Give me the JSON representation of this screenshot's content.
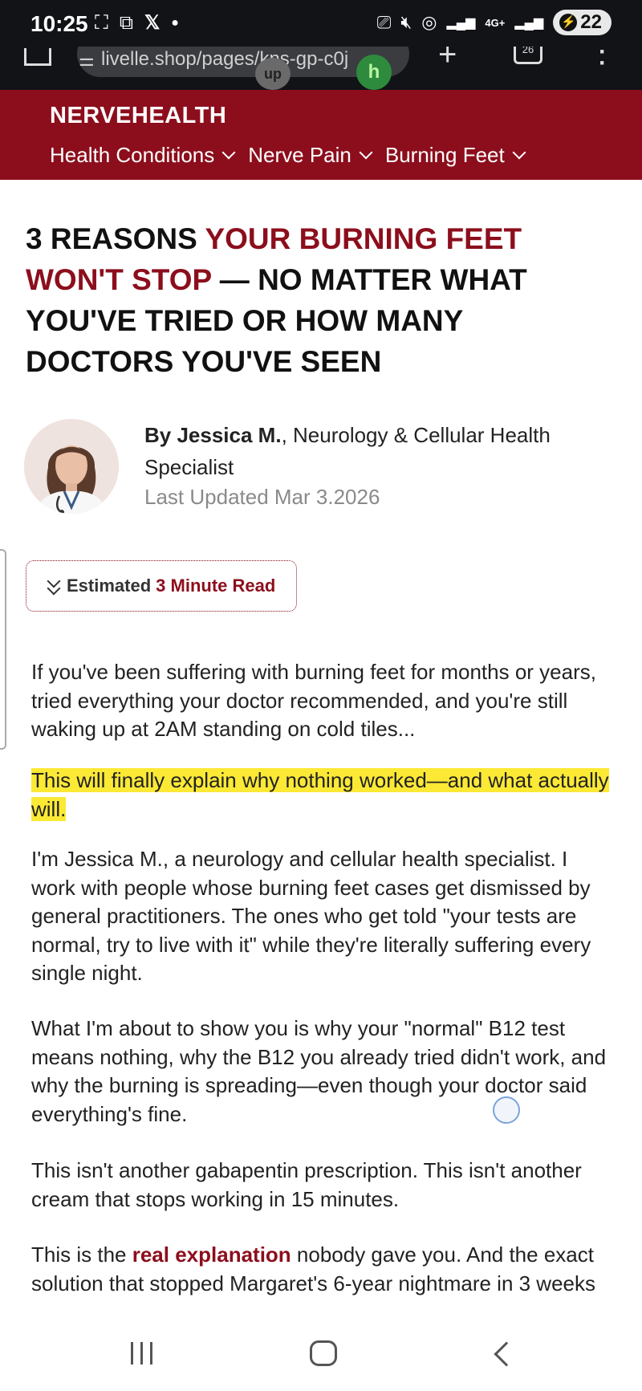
{
  "status_bar": {
    "time": "10:25",
    "left_icons": [
      "screenshot-icon",
      "screen-record-icon",
      "x-app-icon",
      "dot-icon"
    ],
    "network": "4G+",
    "battery": "22"
  },
  "browser": {
    "url": "livelle.shop/pages/kns-gp-c0j",
    "tab_count": "26",
    "extension_1_label": "up",
    "extension_2_label": "h"
  },
  "site": {
    "brand": "NERVEHEALTH",
    "nav": [
      {
        "label": "Health Conditions"
      },
      {
        "label": "Nerve Pain"
      },
      {
        "label": "Burning Feet"
      }
    ]
  },
  "article": {
    "headline_part1": "3 REASONS ",
    "headline_red": "YOUR BURNING FEET WON'T STOP",
    "headline_part2": " — NO MATTER WHAT YOU'VE TRIED OR HOW MANY DOCTORS YOU'VE SEEN",
    "author_prefix": "By Jessica M.",
    "author_title": ", Neurology & Cellular Health Specialist",
    "updated": "Last Updated Mar 3.2026",
    "read_label": "Estimated",
    "read_time": "3 Minute Read",
    "paragraphs": {
      "p1": "If you've been suffering with burning feet for months or years, tried everything your doctor recommended, and you're still waking up at 2AM standing on cold tiles...",
      "p2": "This will finally explain why nothing worked—and what actually will.",
      "p3": "I'm Jessica M., a neurology and cellular health specialist. I work with people whose burning feet cases get dismissed by general practitioners. The ones who get told \"your tests are normal, try to live with it\" while they're literally suffering every single night.",
      "p4": "What I'm about to show you is why your \"normal\" B12 test means nothing, why the B12 you already tried didn't work, and why the burning is spreading—even though your doctor said everything's fine.",
      "p5": "This isn't another gabapentin prescription. This isn't another cream that stops working in 15 minutes.",
      "p6_a": "This is the ",
      "p6_red": "real explanation",
      "p6_b": " nobody gave you. And the exact solution that stopped Margaret's 6-year nightmare in 3 weeks"
    }
  },
  "colors": {
    "brand_red": "#8c0e1c",
    "highlight": "#fbe936",
    "status_bar_bg": "#111317"
  }
}
